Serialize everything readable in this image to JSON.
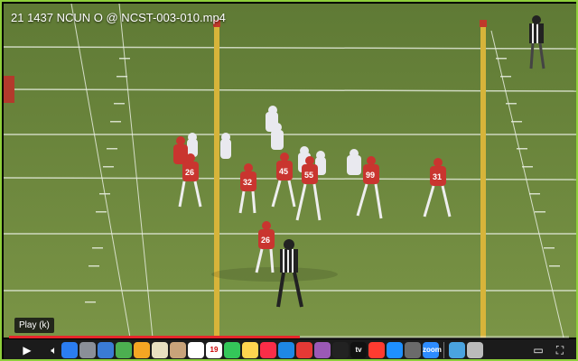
{
  "window": {
    "title": "21 1437 NCUN O @ NCST-003-010.mp4"
  },
  "player": {
    "tooltip": "Play (k)",
    "progress_fraction": 0.52,
    "play_icon": "play-icon",
    "volume_icon": "volume-icon",
    "subtitles_icon": "subtitles-icon",
    "settings_icon": "settings-icon",
    "miniplayer_icon": "miniplayer-icon",
    "fullscreen_icon": "fullscreen-icon"
  },
  "field": {
    "grass_color": "#6e8a3e",
    "goalpost_color": "#d7b43a",
    "line_color": "#e8eee0"
  },
  "players": {
    "red_numbers": [
      "26",
      "32",
      "45",
      "55",
      "99",
      "31",
      "26"
    ],
    "red_color": "#c9352f",
    "white_color": "#e9e9ef"
  },
  "dock": {
    "apps": [
      {
        "name": "finder",
        "label": "",
        "color": "#2b7df0"
      },
      {
        "name": "launchpad",
        "label": "",
        "color": "#8a8f98"
      },
      {
        "name": "preview",
        "label": "",
        "color": "#3a7bd5"
      },
      {
        "name": "maps",
        "label": "",
        "color": "#4caf50"
      },
      {
        "name": "photos",
        "label": "",
        "color": "#f5a623"
      },
      {
        "name": "notes",
        "label": "",
        "color": "#e8e0c0"
      },
      {
        "name": "contacts",
        "label": "",
        "color": "#c8a37a"
      },
      {
        "name": "reminders",
        "label": "",
        "color": "#ffffff"
      },
      {
        "name": "calendar",
        "label": "19",
        "color": "#ffffff"
      },
      {
        "name": "messages",
        "label": "",
        "color": "#34c759"
      },
      {
        "name": "stickies",
        "label": "",
        "color": "#ffd54f"
      },
      {
        "name": "music",
        "label": "",
        "color": "#fa2d48"
      },
      {
        "name": "safari",
        "label": "",
        "color": "#1e88e5"
      },
      {
        "name": "chrome",
        "label": "",
        "color": "#e53935"
      },
      {
        "name": "podcasts",
        "label": "",
        "color": "#9b59b6"
      },
      {
        "name": "siri",
        "label": "",
        "color": "#222"
      },
      {
        "name": "tv",
        "label": "tv",
        "color": "#111"
      },
      {
        "name": "news",
        "label": "",
        "color": "#ff3b30"
      },
      {
        "name": "app-store",
        "label": "",
        "color": "#1e90ff"
      },
      {
        "name": "system-preferences",
        "label": "",
        "color": "#6b6b6b"
      },
      {
        "name": "zoom",
        "label": "zoom",
        "color": "#2d8cff"
      },
      {
        "name": "folder",
        "label": "",
        "color": "#4aa3df"
      },
      {
        "name": "trash",
        "label": "",
        "color": "#bbb"
      }
    ]
  }
}
